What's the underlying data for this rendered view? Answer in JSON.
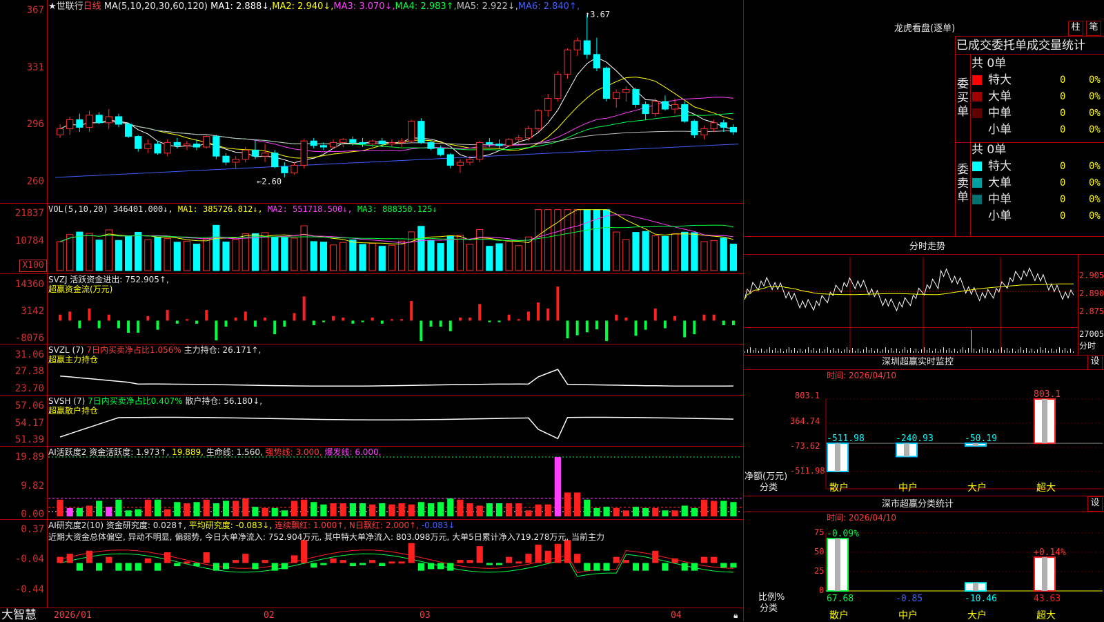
{
  "main_header": {
    "star_name": "★世联行",
    "period": "日线",
    "ma_label": "MA(5,10,20,30,60,120)",
    "ma": [
      {
        "label": "MA1: ",
        "value": "2.888",
        "arrow": "↓",
        "color": "#ffffff"
      },
      {
        "label": "MA2: ",
        "value": "2.940",
        "arrow": "↓",
        "color": "#ffff00"
      },
      {
        "label": "MA3: ",
        "value": "3.070",
        "arrow": "↓",
        "color": "#ff40ff"
      },
      {
        "label": "MA4: ",
        "value": "2.983",
        "arrow": "↑",
        "color": "#00ff40"
      },
      {
        "label": "MA5: ",
        "value": "2.922",
        "arrow": "↓",
        "color": "#c0c0c0"
      },
      {
        "label": "MA6: ",
        "value": "2.840",
        "arrow": "↑",
        "color": "#4060ff"
      }
    ]
  },
  "price_axis": [
    "367",
    "331",
    "296",
    "260"
  ],
  "price_annotations": {
    "high": "3.67",
    "low": "2.60"
  },
  "vol_header": {
    "label": "VOL(5,10,20)",
    "vol": "346401.000↓,",
    "ma1": "MA1: 385726.812↓,",
    "ma2": "MA2: 551718.500↓,",
    "ma3": "MA3: 888350.125↓"
  },
  "vol_axis": [
    "21837",
    "10784",
    "X100"
  ],
  "svzj": {
    "line1_prefix": "SVZJ",
    "line1_text": "活跃资金进出: 752.905↑,",
    "line2": "超赢资金流(万元)",
    "axis": [
      "14360",
      "3142",
      "-8076"
    ]
  },
  "svzl": {
    "prefix": "SVZL (7)",
    "pct": "7日内买卖净占比1.056%",
    "hold": "主力持仓: 26.171↑,",
    "line2": "超赢主力持仓",
    "axis": [
      "31.06",
      "27.38",
      "23.70"
    ]
  },
  "svsh": {
    "prefix": "SVSH (7)",
    "pct": "7日内买卖净占比0.407%",
    "hold": "散户持仓: 56.180↓,",
    "line2": "超赢散户持仓",
    "axis": [
      "57.06",
      "54.17",
      "51.39"
    ]
  },
  "ai2": {
    "text1": "AI活跃度2 资金活跃度: 1.973↑,",
    "v2": "19.889,",
    "life": "生命线: 1.560,",
    "strong": "强势线: 3.000,",
    "burst": "爆发线: 6.000,",
    "axis": [
      "19.89",
      "9.82",
      "0.00"
    ]
  },
  "research": {
    "text1": "AI研究度2(10) 资金研究度: 0.028↑,",
    "avg": "平均研究度: -0.083↓,",
    "cont": "连续飘红: 1.000↑,",
    "nday": "N日飘红: 2.000↑,",
    "neg": "-0.083↓",
    "axis": [
      "0.37",
      "-0.04",
      "-0.44"
    ]
  },
  "commentary": "近期大资金总体偏空, 异动不明显, 偏弱势, 今日大单净流入: 752.904万元, 其中特大单净流入: 803.098万元, 大单5日累计净入719.278万元, 当前主力",
  "date_axis": [
    "2026/01",
    "02",
    "03",
    "04"
  ],
  "brand": "大智慧",
  "right_panel": {
    "title": "龙虎看盘(逐单)",
    "btn_a": "柱",
    "btn_b": "笔",
    "tabs": "已成交委托单成交量统计",
    "buy_label": "委买单",
    "sell_label": "委卖单",
    "buy": {
      "total": "共 0单",
      "rows": [
        {
          "name": "特大",
          "count": "0",
          "pct": "0%",
          "color": "#ff0000"
        },
        {
          "name": "大单",
          "count": "0",
          "pct": "0%",
          "color": "#a00000"
        },
        {
          "name": "中单",
          "count": "0",
          "pct": "0%",
          "color": "#600000"
        },
        {
          "name": "小单",
          "count": "0",
          "pct": "0%",
          "color": "#000000"
        }
      ]
    },
    "sell": {
      "total": "共 0单",
      "rows": [
        {
          "name": "特大",
          "count": "0",
          "pct": "0%",
          "color": "#00ffff"
        },
        {
          "name": "大单",
          "count": "0",
          "pct": "0%",
          "color": "#00a0a0"
        },
        {
          "name": "中单",
          "count": "0",
          "pct": "0%",
          "color": "#007070"
        },
        {
          "name": "小单",
          "count": "0",
          "pct": "0%",
          "color": "#000000"
        }
      ]
    },
    "intraday_title": "分时走势",
    "intraday_axis": [
      "2.905",
      "2.890",
      "2.875"
    ],
    "intraday_vol": [
      "27005",
      "分时"
    ],
    "monitor": {
      "title": "深圳超赢实时监控",
      "btn": "设",
      "time": "时间: 2026/04/10",
      "axis": [
        "803.1",
        "364.74",
        "-73.62",
        "-511.98"
      ],
      "ylabel": "净额(万元)",
      "xlabel": "分类",
      "categories": [
        "散户",
        "中户",
        "大户",
        "超大"
      ],
      "values": [
        -511.98,
        -240.93,
        -50.19,
        803.1
      ],
      "labels": [
        "-511.98",
        "-240.93",
        "-50.19",
        "803.1"
      ]
    },
    "class_stats": {
      "title": "深市超赢分类统计",
      "btn": "设",
      "time": "时间: 2026/04/10",
      "axis": [
        "75",
        "50",
        "25",
        "0"
      ],
      "ylabel": "比例%",
      "xlabel": "分类",
      "categories": [
        "散户",
        "中户",
        "大户",
        "超大"
      ],
      "values": [
        67.68,
        0.85,
        10.46,
        43.63
      ],
      "top_labels": [
        "-0.09%",
        "",
        "",
        "+0.14%"
      ],
      "bottom_labels": [
        "67.68",
        "-0.85",
        "-10.46",
        "43.63"
      ]
    }
  },
  "colors": {
    "up": "#ff3232",
    "down": "#00ffff",
    "frame": "#b00000",
    "ma1": "#ffffff",
    "ma2": "#ffff00",
    "ma3": "#ff40ff",
    "ma4": "#00ff40",
    "ma5": "#c0c0c0",
    "ma6": "#4060ff"
  },
  "chart_data": [
    {
      "type": "candlestick",
      "title": "世联行 日线",
      "ylim": [
        2.55,
        3.7
      ],
      "note": "daily OHLC (approx) Jan–Apr 2026",
      "ohlc": [
        [
          2.88,
          2.95,
          2.86,
          2.92
        ],
        [
          2.92,
          3.0,
          2.88,
          2.98
        ],
        [
          2.98,
          3.02,
          2.9,
          2.93
        ],
        [
          2.93,
          3.04,
          2.9,
          3.01
        ],
        [
          3.01,
          3.03,
          2.95,
          2.96
        ],
        [
          2.96,
          3.05,
          2.92,
          3.0
        ],
        [
          3.0,
          3.02,
          2.93,
          2.95
        ],
        [
          2.95,
          2.96,
          2.86,
          2.87
        ],
        [
          2.87,
          2.88,
          2.77,
          2.79
        ],
        [
          2.79,
          2.85,
          2.76,
          2.82
        ],
        [
          2.82,
          2.84,
          2.75,
          2.76
        ],
        [
          2.76,
          2.85,
          2.74,
          2.83
        ],
        [
          2.83,
          2.86,
          2.79,
          2.81
        ],
        [
          2.81,
          2.84,
          2.78,
          2.82
        ],
        [
          2.82,
          2.85,
          2.78,
          2.8
        ],
        [
          2.8,
          2.88,
          2.79,
          2.87
        ],
        [
          2.87,
          2.88,
          2.72,
          2.74
        ],
        [
          2.74,
          2.76,
          2.68,
          2.7
        ],
        [
          2.7,
          2.74,
          2.66,
          2.72
        ],
        [
          2.72,
          2.8,
          2.7,
          2.78
        ],
        [
          2.78,
          2.85,
          2.72,
          2.74
        ],
        [
          2.74,
          2.82,
          2.7,
          2.76
        ],
        [
          2.76,
          2.78,
          2.66,
          2.67
        ],
        [
          2.67,
          2.7,
          2.6,
          2.63
        ],
        [
          2.63,
          2.7,
          2.62,
          2.68
        ],
        [
          2.68,
          2.85,
          2.66,
          2.84
        ],
        [
          2.84,
          2.86,
          2.79,
          2.81
        ],
        [
          2.81,
          2.83,
          2.78,
          2.8
        ],
        [
          2.8,
          2.85,
          2.79,
          2.83
        ],
        [
          2.83,
          2.86,
          2.8,
          2.85
        ],
        [
          2.85,
          2.87,
          2.81,
          2.83
        ],
        [
          2.83,
          2.86,
          2.8,
          2.82
        ],
        [
          2.82,
          2.85,
          2.8,
          2.84
        ],
        [
          2.84,
          2.86,
          2.8,
          2.82
        ],
        [
          2.82,
          2.85,
          2.8,
          2.83
        ],
        [
          2.83,
          2.86,
          2.8,
          2.84
        ],
        [
          2.84,
          2.98,
          2.83,
          2.97
        ],
        [
          2.97,
          2.99,
          2.82,
          2.83
        ],
        [
          2.83,
          2.84,
          2.78,
          2.79
        ],
        [
          2.79,
          2.81,
          2.74,
          2.75
        ],
        [
          2.75,
          2.76,
          2.66,
          2.68
        ],
        [
          2.68,
          2.72,
          2.63,
          2.7
        ],
        [
          2.7,
          2.74,
          2.68,
          2.72
        ],
        [
          2.72,
          2.84,
          2.7,
          2.83
        ],
        [
          2.83,
          2.86,
          2.8,
          2.82
        ],
        [
          2.82,
          2.85,
          2.79,
          2.81
        ],
        [
          2.81,
          2.86,
          2.8,
          2.85
        ],
        [
          2.85,
          2.88,
          2.82,
          2.86
        ],
        [
          2.86,
          2.94,
          2.84,
          2.92
        ],
        [
          2.92,
          3.05,
          2.9,
          3.04
        ],
        [
          3.04,
          3.15,
          3.0,
          3.12
        ],
        [
          3.12,
          3.3,
          3.1,
          3.28
        ],
        [
          3.28,
          3.45,
          3.25,
          3.44
        ],
        [
          3.44,
          3.52,
          3.4,
          3.5
        ],
        [
          3.5,
          3.67,
          3.38,
          3.41
        ],
        [
          3.41,
          3.52,
          3.3,
          3.32
        ],
        [
          3.32,
          3.33,
          3.1,
          3.12
        ],
        [
          3.12,
          3.18,
          3.06,
          3.16
        ],
        [
          3.16,
          3.2,
          3.1,
          3.18
        ],
        [
          3.18,
          3.19,
          3.06,
          3.08
        ],
        [
          3.08,
          3.1,
          2.98,
          3.02
        ],
        [
          3.02,
          3.12,
          3.0,
          3.1
        ],
        [
          3.1,
          3.14,
          3.04,
          3.05
        ],
        [
          3.05,
          3.12,
          3.02,
          3.08
        ],
        [
          3.08,
          3.1,
          2.96,
          2.97
        ],
        [
          2.97,
          2.98,
          2.86,
          2.88
        ],
        [
          2.88,
          2.94,
          2.85,
          2.92
        ],
        [
          2.92,
          2.98,
          2.9,
          2.96
        ],
        [
          2.96,
          2.98,
          2.9,
          2.93
        ],
        [
          2.93,
          2.95,
          2.88,
          2.9
        ]
      ]
    },
    {
      "type": "bar",
      "title": "VOL(5,10,20)",
      "ylim": [
        0,
        25000
      ],
      "unit": "X100"
    },
    {
      "type": "bar",
      "title": "超赢资金流(万元)",
      "ylim": [
        -8076,
        14360
      ]
    },
    {
      "type": "line",
      "title": "超赢主力持仓",
      "ylim": [
        23.7,
        31.06
      ]
    },
    {
      "type": "line",
      "title": "超赢散户持仓",
      "ylim": [
        51.39,
        57.06
      ]
    },
    {
      "type": "bar",
      "title": "AI活跃度2",
      "ylim": [
        0,
        19.89
      ]
    },
    {
      "type": "bar",
      "title": "AI研究度2(10)",
      "ylim": [
        -0.44,
        0.37
      ]
    },
    {
      "type": "bar",
      "title": "深圳超赢实时监控",
      "categories": [
        "散户",
        "中户",
        "大户",
        "超大"
      ],
      "values": [
        -511.98,
        -240.93,
        -50.19,
        803.1
      ],
      "ylim": [
        -511.98,
        803.1
      ],
      "ylabel": "净额(万元)",
      "xlabel": "分类"
    },
    {
      "type": "bar",
      "title": "深市超赢分类统计",
      "categories": [
        "散户",
        "中户",
        "大户",
        "超大"
      ],
      "values": [
        67.68,
        0.85,
        10.46,
        43.63
      ],
      "ylim": [
        0,
        75
      ],
      "ylabel": "比例%",
      "xlabel": "分类"
    }
  ]
}
